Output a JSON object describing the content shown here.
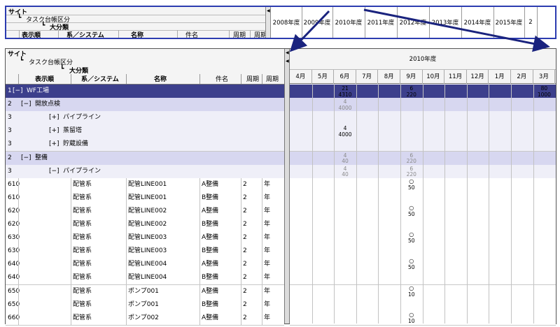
{
  "header_labels": {
    "site": "サイト",
    "task_category": "タスク台帳区分",
    "major_category": "大分類",
    "display_order": "表示順",
    "system": "系／システム",
    "name": "名称",
    "subject": "件名",
    "cycle": "周期"
  },
  "year_columns": [
    "2008年度",
    "2009年度",
    "2010年度",
    "2011年度",
    "2012年度",
    "2013年度",
    "2014年度",
    "2015年度",
    "2"
  ],
  "fiscal_year": "2010年度",
  "months": [
    "4月",
    "5月",
    "6月",
    "7月",
    "8月",
    "9月",
    "10月",
    "11月",
    "12月",
    "1月",
    "2月",
    "3月"
  ],
  "tree_rows": [
    {
      "level": "1",
      "toggle": "[−]",
      "label": "WF工場",
      "cells": {
        "6月": [
          "21",
          "4310"
        ],
        "9月": [
          "6",
          "220"
        ],
        "3月": [
          "80",
          "1000"
        ]
      }
    },
    {
      "level": "2",
      "toggle": "[−]",
      "label": "開放点検",
      "cells": {
        "6月": [
          "4",
          "4000"
        ]
      }
    },
    {
      "level": "3",
      "toggle": "[+]",
      "label": "パイプライン",
      "cells": {}
    },
    {
      "level": "3",
      "toggle": "[+]",
      "label": "蒸留塔",
      "cells": {
        "6月": [
          "4",
          "4000"
        ]
      }
    },
    {
      "level": "3",
      "toggle": "[+]",
      "label": "貯蔵設備",
      "cells": {}
    },
    {
      "level": "2",
      "toggle": "[−]",
      "label": "整備",
      "cells": {
        "6月": [
          "4",
          "40"
        ],
        "9月": [
          "6",
          "220"
        ]
      }
    },
    {
      "level": "3",
      "toggle": "[−]",
      "label": "パイプライン",
      "cells": {
        "6月": [
          "4",
          "40"
        ],
        "9月": [
          "6",
          "220"
        ]
      }
    }
  ],
  "detail_rows": [
    {
      "order": "610",
      "system": "配管系",
      "name": "配管LINE001",
      "subject": "A整備",
      "cycle": "2",
      "unit": "年",
      "mark": "○",
      "value": "50"
    },
    {
      "order": "610",
      "system": "配管系",
      "name": "配管LINE001",
      "subject": "B整備",
      "cycle": "2",
      "unit": "年",
      "mark": "",
      "value": ""
    },
    {
      "order": "620",
      "system": "配管系",
      "name": "配管LINE002",
      "subject": "A整備",
      "cycle": "2",
      "unit": "年",
      "mark": "○",
      "value": "50"
    },
    {
      "order": "620",
      "system": "配管系",
      "name": "配管LINE002",
      "subject": "B整備",
      "cycle": "2",
      "unit": "年",
      "mark": "",
      "value": ""
    },
    {
      "order": "630",
      "system": "配管系",
      "name": "配管LINE003",
      "subject": "A整備",
      "cycle": "2",
      "unit": "年",
      "mark": "○",
      "value": "50"
    },
    {
      "order": "630",
      "system": "配管系",
      "name": "配管LINE003",
      "subject": "B整備",
      "cycle": "2",
      "unit": "年",
      "mark": "",
      "value": ""
    },
    {
      "order": "640",
      "system": "配管系",
      "name": "配管LINE004",
      "subject": "A整備",
      "cycle": "2",
      "unit": "年",
      "mark": "○",
      "value": "50"
    },
    {
      "order": "640",
      "system": "配管系",
      "name": "配管LINE004",
      "subject": "B整備",
      "cycle": "2",
      "unit": "年",
      "mark": "",
      "value": ""
    },
    {
      "order": "650",
      "system": "配管系",
      "name": "ポンプ001",
      "subject": "A整備",
      "cycle": "2",
      "unit": "年",
      "mark": "○",
      "value": "10"
    },
    {
      "order": "650",
      "system": "配管系",
      "name": "ポンプ001",
      "subject": "B整備",
      "cycle": "2",
      "unit": "年",
      "mark": "",
      "value": ""
    },
    {
      "order": "660",
      "system": "配管系",
      "name": "ポンプ002",
      "subject": "A整備",
      "cycle": "2",
      "unit": "年",
      "mark": "○",
      "value": "10"
    }
  ],
  "colors": {
    "level1": "#3c3f8c",
    "level2": "#d7d7f0",
    "level3": "#efeff8",
    "arrow": "#1a237e",
    "frame": "#2c3cb0"
  }
}
